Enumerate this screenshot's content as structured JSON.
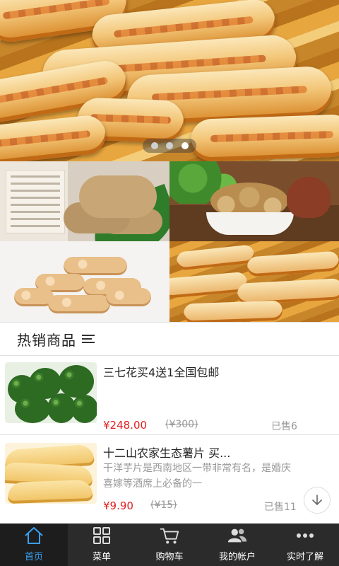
{
  "banner": {
    "dots": 3,
    "active_dot": 3
  },
  "section": {
    "title": "热销商品"
  },
  "products": [
    {
      "name": "三七花买4送1全国包邮",
      "description": "",
      "price": "¥248.00",
      "original_price": "(¥300)",
      "sold": "已售6"
    },
    {
      "name": "十二山农家生态薯片 买...",
      "description": "干洋芋片是西南地区一带非常有名，是婚庆喜嫁等酒席上必备的一",
      "price": "¥9.90",
      "original_price": "(¥15)",
      "sold": "已售11"
    }
  ],
  "nav": {
    "items": [
      {
        "label": "首页",
        "icon": "home-icon",
        "active": true
      },
      {
        "label": "菜单",
        "icon": "grid-icon",
        "active": false
      },
      {
        "label": "购物车",
        "icon": "cart-icon",
        "active": false
      },
      {
        "label": "我的帐户",
        "icon": "users-icon",
        "active": false
      },
      {
        "label": "实时了解",
        "icon": "more-icon",
        "active": false
      }
    ],
    "active_color": "#3aa0f0",
    "background": "#2b2b2b"
  },
  "colors": {
    "price": "#e02020",
    "muted": "#999999"
  }
}
